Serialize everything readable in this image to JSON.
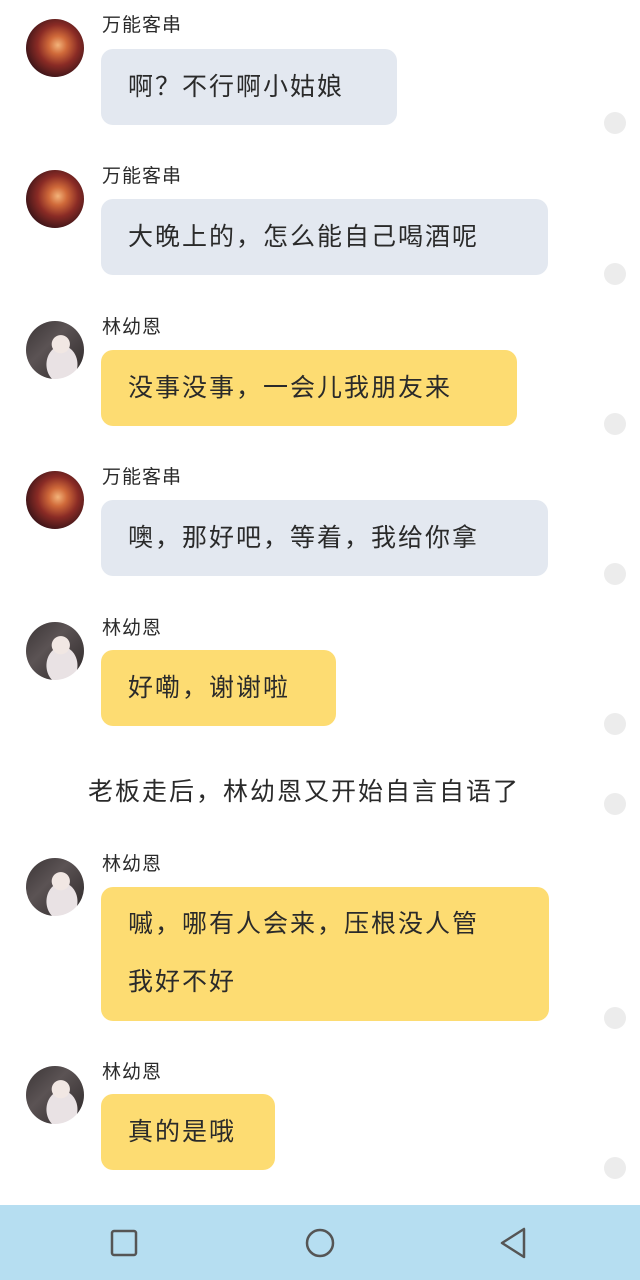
{
  "messages": [
    {
      "sender": "万能客串",
      "text": "啊？不行啊小姑娘",
      "style": "grey",
      "avatar": "shopkeeper-avatar"
    },
    {
      "sender": "万能客串",
      "text": "大晚上的，怎么能自己喝酒呢",
      "style": "grey",
      "avatar": "shopkeeper-avatar"
    },
    {
      "sender": "林幼恩",
      "text": "没事没事，一会儿我朋友来",
      "style": "yellow",
      "avatar": "girl-avatar"
    },
    {
      "sender": "万能客串",
      "text": "噢，那好吧，等着，我给你拿",
      "style": "grey",
      "avatar": "shopkeeper-avatar"
    },
    {
      "sender": "林幼恩",
      "text": "好嘞，谢谢啦",
      "style": "yellow",
      "avatar": "girl-avatar"
    },
    {
      "sender": "林幼恩",
      "text_line1": "嘁，哪有人会来，压根没人管",
      "text_line2": "我好不好",
      "style": "yellow",
      "avatar": "girl-avatar"
    },
    {
      "sender": "林幼恩",
      "text": "真的是哦",
      "style": "yellow",
      "avatar": "girl-avatar"
    }
  ],
  "narration": "老板走后，林幼恩又开始自言自语了",
  "navbar": {
    "icons": [
      "square-icon",
      "circle-icon",
      "triangle-back-icon"
    ]
  },
  "colors": {
    "grey_bubble": "#e3e8f0",
    "yellow_bubble": "#fddc72",
    "navbar": "#b6def1"
  }
}
